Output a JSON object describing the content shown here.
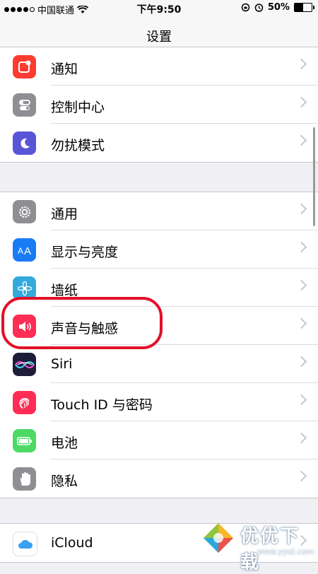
{
  "status_bar": {
    "carrier": "中国联通",
    "time": "下午9:50",
    "battery": "50%",
    "battery_level": 0.5
  },
  "nav": {
    "title": "设置"
  },
  "groups": [
    {
      "items": [
        {
          "label": "通知",
          "icon": "notification-icon",
          "color": "#fd3b30"
        },
        {
          "label": "控制中心",
          "icon": "control-center-icon",
          "color": "#8e8e93"
        },
        {
          "label": "勿扰模式",
          "icon": "moon-icon",
          "color": "#5856d6"
        }
      ]
    },
    {
      "items": [
        {
          "label": "通用",
          "icon": "gear-icon",
          "color": "#8e8e93"
        },
        {
          "label": "显示与亮度",
          "icon": "display-brightness-icon",
          "color": "#1a7cf5"
        },
        {
          "label": "墙纸",
          "icon": "wallpaper-icon",
          "color": "#34aadc"
        },
        {
          "label": "声音与触感",
          "icon": "sound-icon",
          "color": "#fd2d55"
        },
        {
          "label": "Siri",
          "icon": "siri-icon",
          "color": "#1d1d3a"
        },
        {
          "label": "Touch ID 与密码",
          "icon": "fingerprint-icon",
          "color": "#fd2d55"
        },
        {
          "label": "电池",
          "icon": "battery-icon",
          "color": "#4cd964"
        },
        {
          "label": "隐私",
          "icon": "hand-icon",
          "color": "#8e8e93"
        }
      ]
    },
    {
      "items": [
        {
          "label": "iCloud",
          "icon": "icloud-icon",
          "color": "#ffffff"
        }
      ]
    }
  ],
  "watermark": {
    "title": "优优下载",
    "url": "www.yyxt.com"
  }
}
